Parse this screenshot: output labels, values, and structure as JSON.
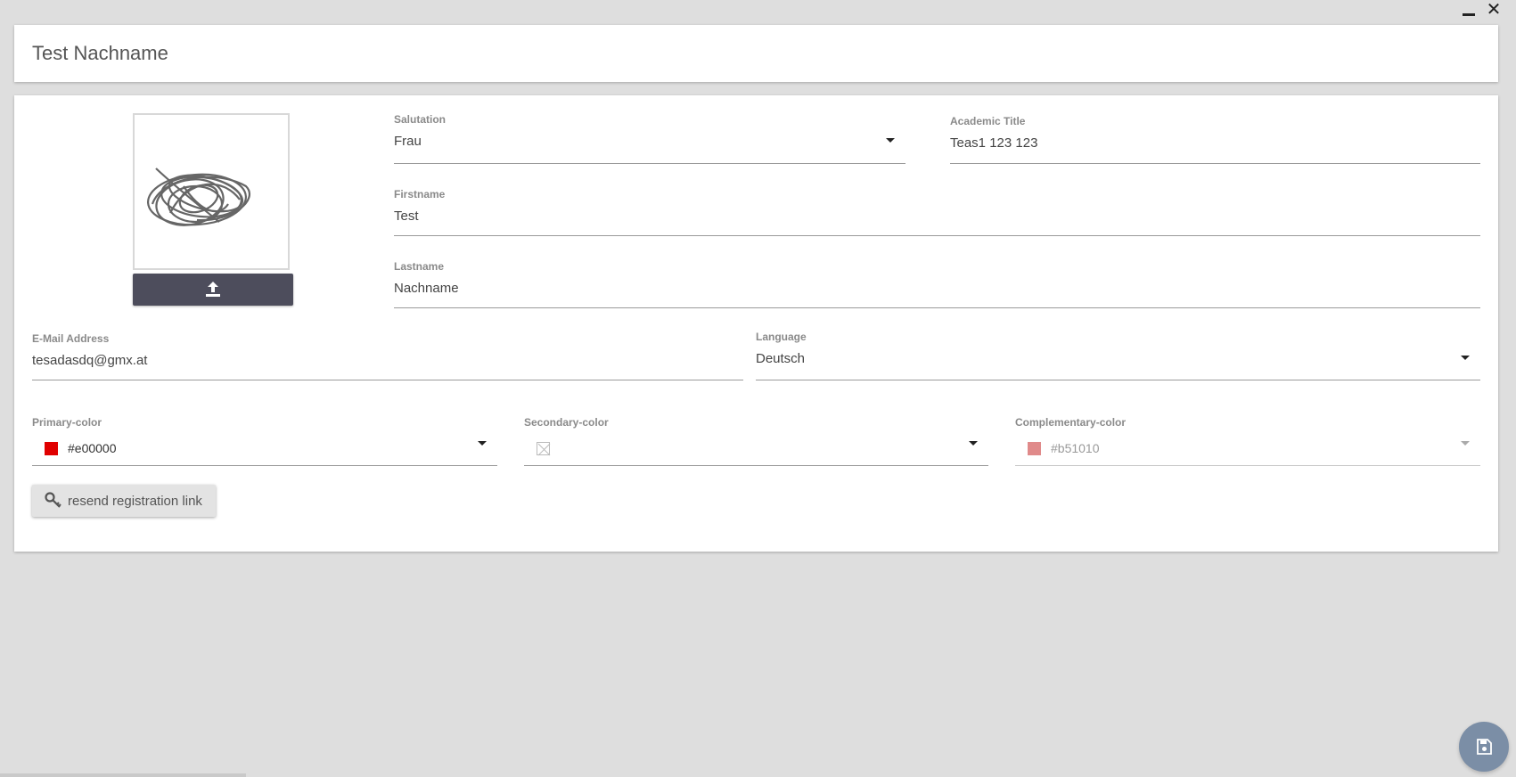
{
  "header": {
    "title": "Test Nachname"
  },
  "window": {
    "minimize_icon": "minimize-icon",
    "close_icon": "close-icon"
  },
  "avatar": {
    "upload_icon": "upload-icon"
  },
  "form": {
    "salutation": {
      "label": "Salutation",
      "value": "Frau"
    },
    "academic_title": {
      "label": "Academic Title",
      "value": "Teas1 123 123"
    },
    "firstname": {
      "label": "Firstname",
      "value": "Test"
    },
    "lastname": {
      "label": "Lastname",
      "value": "Nachname"
    },
    "email": {
      "label": "E-Mail Address",
      "value": "tesadasdq@gmx.at"
    },
    "language": {
      "label": "Language",
      "value": "Deutsch"
    },
    "primary_color": {
      "label": "Primary-color",
      "value": "#e00000",
      "swatch": "#e00000"
    },
    "secondary_color": {
      "label": "Secondary-color",
      "value": ""
    },
    "complementary_color": {
      "label": "Complementary-color",
      "value": "#b51010",
      "swatch": "#e08a8a"
    }
  },
  "actions": {
    "resend_label": "resend registration link",
    "resend_icon": "key-icon",
    "save_icon": "save-icon"
  },
  "colors": {
    "fab": "#7b8ea6",
    "upload_button": "#4d4d5c",
    "background": "#dedede"
  }
}
